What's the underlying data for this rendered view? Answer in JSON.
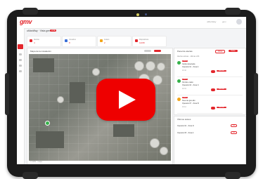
{
  "header": {
    "logo_text": "gmv",
    "top_right_1": "uManWay",
    "top_right_2": "gmv"
  },
  "page": {
    "title": "uManWay · Vista general",
    "badge": "LIVE"
  },
  "cards": [
    {
      "label": "Alertas",
      "value": "4",
      "icon": "alert-icon",
      "color": "#e3262c"
    },
    {
      "label": "Usuarios",
      "value": "8",
      "icon": "users-icon",
      "color": "#3b6fd8"
    },
    {
      "label": "Avisos",
      "value": "2",
      "icon": "warning-icon",
      "color": "#f2a51a"
    },
    {
      "label": "Dispositivos",
      "value": "12/08",
      "icon": "devices-icon",
      "color": "#e3262c"
    }
  ],
  "map_panel": {
    "title": "Mapa de la instalación",
    "footer": "© GMV · mapa"
  },
  "alerts_panel": {
    "title": "Panel de alertas",
    "button_1": "Filtrar",
    "button_2": "Todas",
    "subtitle": "Alertas activas · últimas 24h",
    "items": [
      {
        "tag": "SOS",
        "line1": "Caída detectada",
        "line2": "Operario 01 · Zona A",
        "time": "10:42",
        "action": "Atender",
        "dot_color": "#36b24a"
      },
      {
        "tag": "SOS",
        "line1": "Hombre caído",
        "line2": "Operario 04 · Zona C",
        "time": "10:31",
        "action": "Atender",
        "dot_color": "#36b24a"
      },
      {
        "tag": "GAS",
        "line1": "Nivel de gas alto",
        "line2": "Operario 07 · Zona B",
        "time": "10:12",
        "action": "Atender",
        "dot_color": "#f2a51a"
      }
    ]
  },
  "second_panel": {
    "title": "Últimos avisos",
    "items": [
      {
        "label": "Operario 02 · Zona D",
        "action": "Ver"
      },
      {
        "label": "Operario 05 · Zona A",
        "action": "Ver"
      }
    ]
  },
  "video": {
    "play_icon": "play-icon",
    "play_color": "#ee0000"
  }
}
